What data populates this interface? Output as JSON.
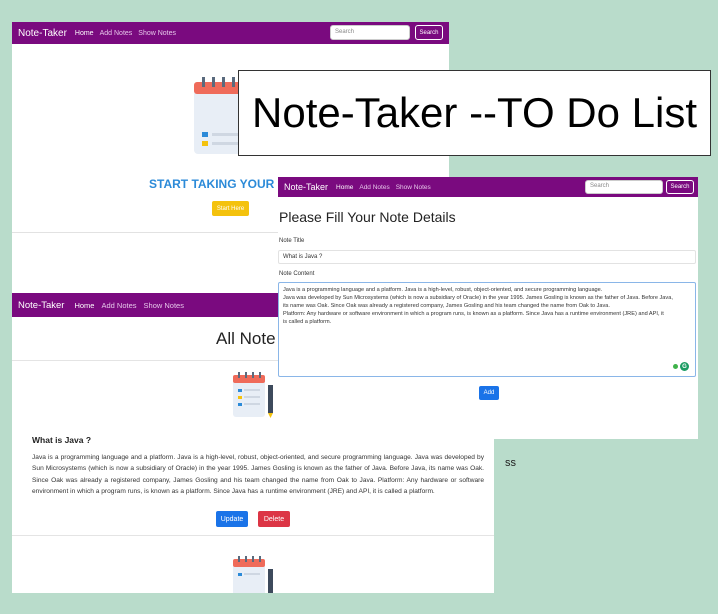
{
  "app": {
    "brand": "Note-Taker"
  },
  "nav": {
    "home": "Home",
    "add_notes": "Add Notes",
    "show_notes": "Show Notes"
  },
  "search": {
    "placeholder": "Search",
    "button": "Search"
  },
  "landing": {
    "headline": "START TAKING YOUR N",
    "start_button": "Start Here"
  },
  "overlay_title": "Note-Taker --TO Do List",
  "add_form": {
    "heading": "Please Fill Your Note Details",
    "title_label": "Note Title",
    "title_value": "What is Java ?",
    "content_label": "Note Content",
    "content_lines": [
      "Java is a programming language and a platform. Java is a high-level, robust, object-oriented, and secure programming language.",
      "Java was developed by Sun Microsystems (which is now a subsidiary of Oracle) in the year 1995. James Gosling is known as the father of Java. Before Java,",
      "its name was Oak. Since Oak was already a registered company, James Gosling and his team changed the name from Oak to Java.",
      "Platform: Any hardware or software environment in which a program runs, is known as a platform. Since Java has a runtime environment (JRE) and API, it",
      "is called a platform."
    ],
    "add_button": "Add"
  },
  "all_notes": {
    "heading": "All Note",
    "note_title": "What is Java ?",
    "note_content": "Java is a programming language and a platform. Java is a high-level, robust, object-oriented, and secure programming language. Java was developed by Sun Microsystems (which is now a subsidiary of Oracle) in the year 1995. James Gosling is known as the father of Java. Before Java, its name was Oak. Since Oak was already a registered company, James Gosling and his team changed the name from Oak to Java. Platform: Any hardware or software environment in which a program runs, is known as a platform. Since Java has a runtime environment (JRE) and API, it is called a platform.",
    "update_button": "Update",
    "delete_button": "Delete"
  },
  "side_label": "ss",
  "colors": {
    "nav": "#7a0a7f",
    "primary": "#1a73e8",
    "danger": "#dc3545",
    "warning": "#f4c20d",
    "headline": "#2b8ad8",
    "background": "#b9dccb"
  },
  "icons": {
    "illustration": "notepad-pen-icon",
    "grammar": "grammarly-icon"
  }
}
